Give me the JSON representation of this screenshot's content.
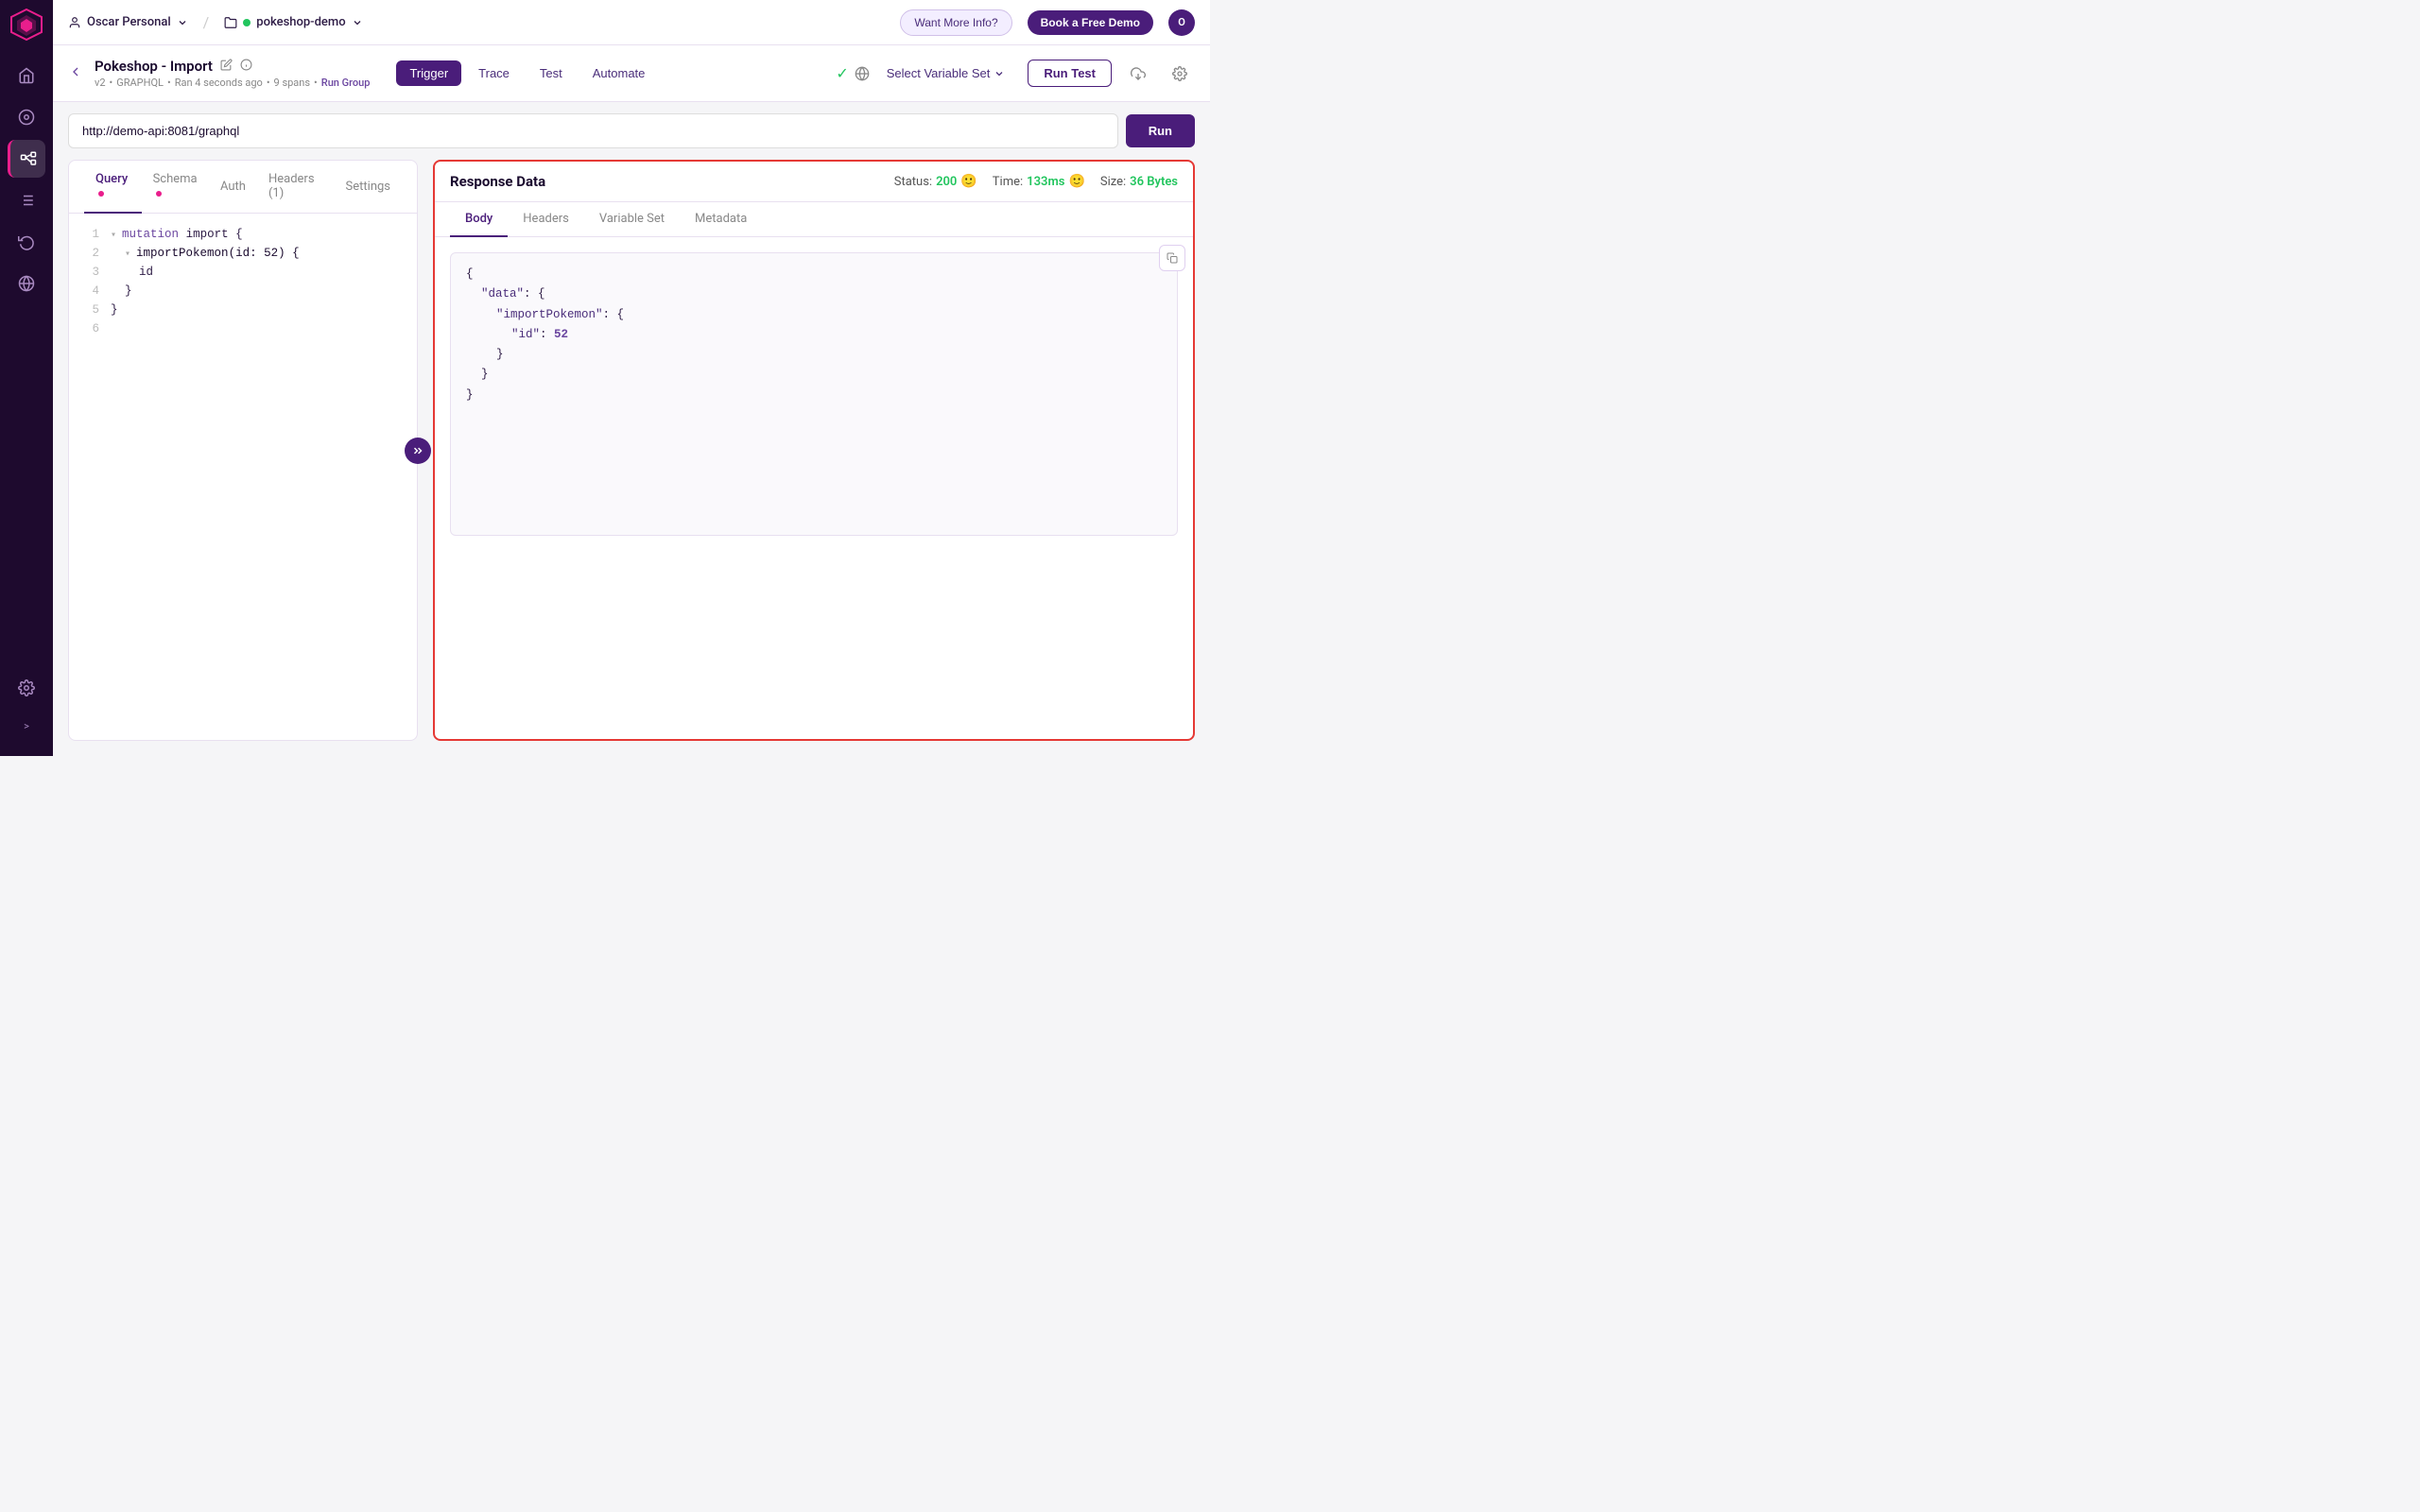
{
  "topbar": {
    "user": "Oscar Personal",
    "project": "pokeshop-demo",
    "info_label": "Want More Info?",
    "demo_label": "Book a Free Demo",
    "avatar_initial": "O"
  },
  "page": {
    "title": "Pokeshop - Import",
    "meta_version": "v2",
    "meta_type": "GRAPHQL",
    "meta_ran": "Ran 4 seconds ago",
    "meta_spans": "9 spans",
    "meta_run_group": "Run Group"
  },
  "tabs": {
    "trigger": "Trigger",
    "trace": "Trace",
    "test": "Test",
    "automate": "Automate"
  },
  "header": {
    "select_variable_set": "Select Variable Set",
    "run_test": "Run Test"
  },
  "url_bar": {
    "url": "http://demo-api:8081/graphql",
    "run": "Run"
  },
  "query_tabs": [
    {
      "label": "Query",
      "has_dot": true,
      "active": true
    },
    {
      "label": "Schema",
      "has_dot": true,
      "active": false
    },
    {
      "label": "Auth",
      "has_dot": false,
      "active": false
    },
    {
      "label": "Headers (1)",
      "has_dot": false,
      "active": false
    },
    {
      "label": "Settings",
      "has_dot": false,
      "active": false
    }
  ],
  "code_lines": [
    {
      "num": "1",
      "content": "mutation import {",
      "type": "keyword"
    },
    {
      "num": "2",
      "content": "  importPokemon(id: 52) {",
      "type": "func"
    },
    {
      "num": "3",
      "content": "    id",
      "type": "field"
    },
    {
      "num": "4",
      "content": "  }",
      "type": "brace"
    },
    {
      "num": "5",
      "content": "}",
      "type": "brace"
    },
    {
      "num": "6",
      "content": "",
      "type": "empty"
    }
  ],
  "response": {
    "title": "Response Data",
    "status_label": "Status:",
    "status_value": "200",
    "time_label": "Time:",
    "time_value": "133ms",
    "size_label": "Size:",
    "size_value": "36 Bytes",
    "tabs": [
      "Body",
      "Headers",
      "Variable Set",
      "Metadata"
    ],
    "active_tab": "Body",
    "json": {
      "line1": "{",
      "line2": "  \"data\": {",
      "line3": "    \"importPokemon\": {",
      "line4": "      \"id\": 52",
      "line5": "    }",
      "line6": "  }",
      "line7": "}"
    }
  },
  "sidebar": {
    "items": [
      {
        "name": "home",
        "icon": "⌂",
        "active": false
      },
      {
        "name": "analytics",
        "icon": "◎",
        "active": false
      },
      {
        "name": "network",
        "icon": "⬡",
        "active": true
      },
      {
        "name": "list",
        "icon": "☰",
        "active": false
      },
      {
        "name": "history",
        "icon": "↺",
        "active": false
      },
      {
        "name": "globe",
        "icon": "⊕",
        "active": false
      },
      {
        "name": "settings",
        "icon": "⚙",
        "active": false
      }
    ],
    "collapse_label": ">"
  }
}
